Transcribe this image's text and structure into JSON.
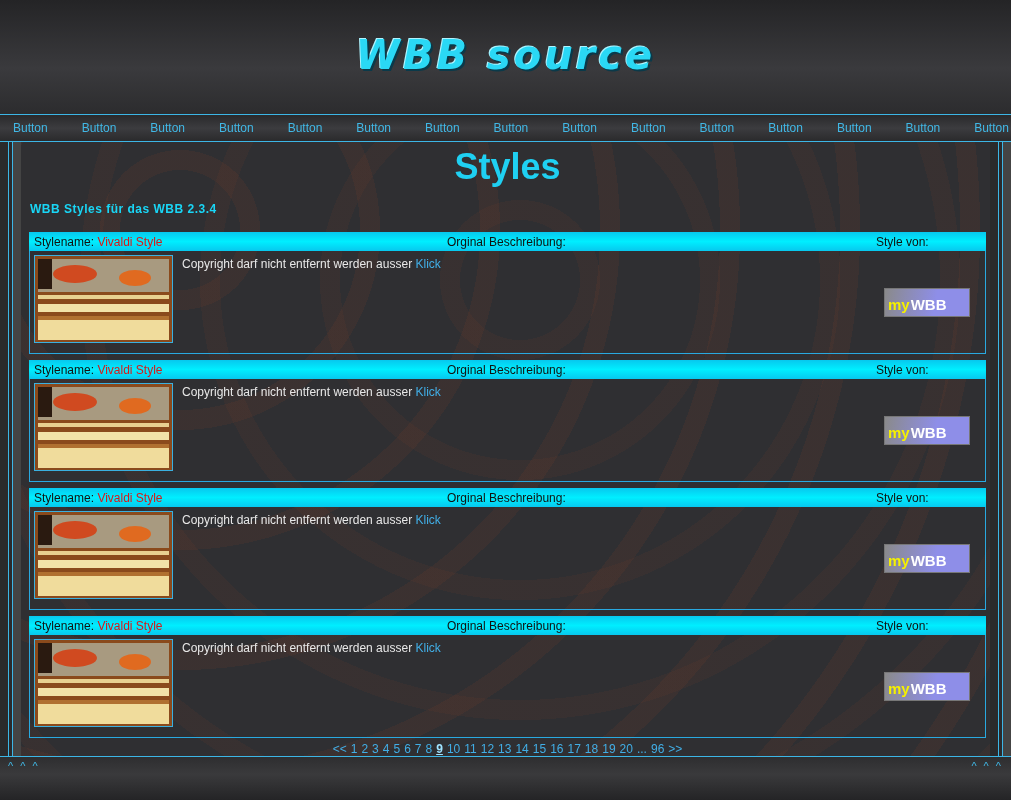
{
  "header": {
    "logo": "WBB source"
  },
  "nav": {
    "buttons": [
      "Button",
      "Button",
      "Button",
      "Button",
      "Button",
      "Button",
      "Button",
      "Button",
      "Button",
      "Button",
      "Button",
      "Button",
      "Button",
      "Button",
      "Button"
    ]
  },
  "page": {
    "title": "Styles",
    "subtitle": "WBB Styles für das WBB 2.3.4"
  },
  "styles": [
    {
      "name_label": "Stylename:",
      "name": "Vivaldi Style",
      "description_label": "Orginal Beschreibung:",
      "author_label": "Style von:",
      "text": "Copyright darf nicht entfernt werden ausser",
      "link": "Klick",
      "banner": {
        "prefix": "my",
        "brand": "WBB"
      }
    },
    {
      "name_label": "Stylename:",
      "name": "Vivaldi Style",
      "description_label": "Orginal Beschreibung:",
      "author_label": "Style von:",
      "text": "Copyright darf nicht entfernt werden ausser",
      "link": "Klick",
      "banner": {
        "prefix": "my",
        "brand": "WBB"
      }
    },
    {
      "name_label": "Stylename:",
      "name": "Vivaldi Style",
      "description_label": "Orginal Beschreibung:",
      "author_label": "Style von:",
      "text": "Copyright darf nicht entfernt werden ausser",
      "link": "Klick",
      "banner": {
        "prefix": "my",
        "brand": "WBB"
      }
    },
    {
      "name_label": "Stylename:",
      "name": "Vivaldi Style",
      "description_label": "Orginal Beschreibung:",
      "author_label": "Style von:",
      "text": "Copyright darf nicht entfernt werden ausser",
      "link": "Klick",
      "banner": {
        "prefix": "my",
        "brand": "WBB"
      }
    }
  ],
  "pagination": [
    {
      "label": "<<",
      "selected": false
    },
    {
      "label": "1",
      "selected": false
    },
    {
      "label": "2",
      "selected": false
    },
    {
      "label": "3",
      "selected": false
    },
    {
      "label": "4",
      "selected": false
    },
    {
      "label": "5",
      "selected": false
    },
    {
      "label": "6",
      "selected": false
    },
    {
      "label": "7",
      "selected": false
    },
    {
      "label": "8",
      "selected": false
    },
    {
      "label": "9",
      "selected": true
    },
    {
      "label": "10",
      "selected": false
    },
    {
      "label": "11",
      "selected": false
    },
    {
      "label": "12",
      "selected": false
    },
    {
      "label": "13",
      "selected": false
    },
    {
      "label": "14",
      "selected": false
    },
    {
      "label": "15",
      "selected": false
    },
    {
      "label": "16",
      "selected": false
    },
    {
      "label": "17",
      "selected": false
    },
    {
      "label": "18",
      "selected": false
    },
    {
      "label": "19",
      "selected": false
    },
    {
      "label": "20",
      "selected": false
    },
    {
      "label": "...",
      "selected": false
    },
    {
      "label": "96",
      "selected": false
    },
    {
      "label": ">>",
      "selected": false
    }
  ],
  "footer": {
    "left_marks": "^ ^ ^",
    "right_marks": "^ ^ ^"
  }
}
